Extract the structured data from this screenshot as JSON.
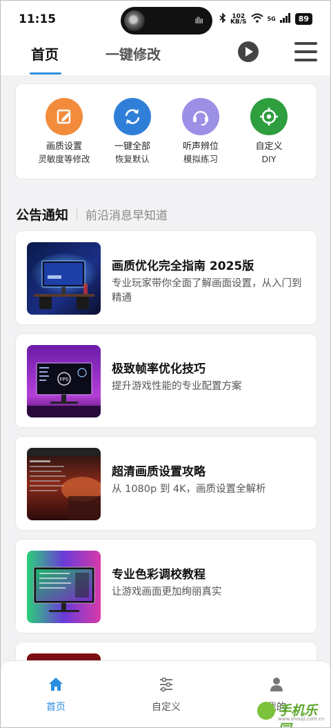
{
  "status": {
    "time": "11:15",
    "net_rate_top": "102",
    "net_rate_unit": "KB/S",
    "signal": "5G",
    "battery": "89"
  },
  "topnav": {
    "tab_home": "首页",
    "tab_modify": "一键修改"
  },
  "quick_actions": [
    {
      "label": "画质设置",
      "sub": "灵敏度等修改",
      "icon": "edit-icon",
      "color": "#f28c3c"
    },
    {
      "label": "一键全部",
      "sub": "恢复默认",
      "icon": "refresh-icon",
      "color": "#2f7fd8"
    },
    {
      "label": "听声辨位",
      "sub": "模拟练习",
      "icon": "headset-icon",
      "color": "#9b8fe6"
    },
    {
      "label": "自定义",
      "sub": "DIY",
      "icon": "crosshair-icon",
      "color": "#2e9e3e"
    }
  ],
  "notice": {
    "title": "公告通知",
    "subtitle": "前沿消息早知道"
  },
  "articles": [
    {
      "title": "画质优化完全指南 2025版",
      "desc": "专业玩家带你全面了解画面设置，从入门到精通"
    },
    {
      "title": "极致帧率优化技巧",
      "desc": "提升游戏性能的专业配置方案"
    },
    {
      "title": "超清画质设置攻略",
      "desc": "从 1080p 到 4K，画质设置全解析"
    },
    {
      "title": "专业色彩调校教程",
      "desc": "让游戏画面更加绚丽真实"
    }
  ],
  "thumb_text": {
    "fps": "FPS"
  },
  "bottom_nav": {
    "home": "首页",
    "custom": "自定义",
    "mine": "我的"
  },
  "watermark": {
    "text": "手机乐园",
    "url": "www.shouji.com.cn"
  },
  "colors": {
    "accent": "#2b8ee0"
  }
}
